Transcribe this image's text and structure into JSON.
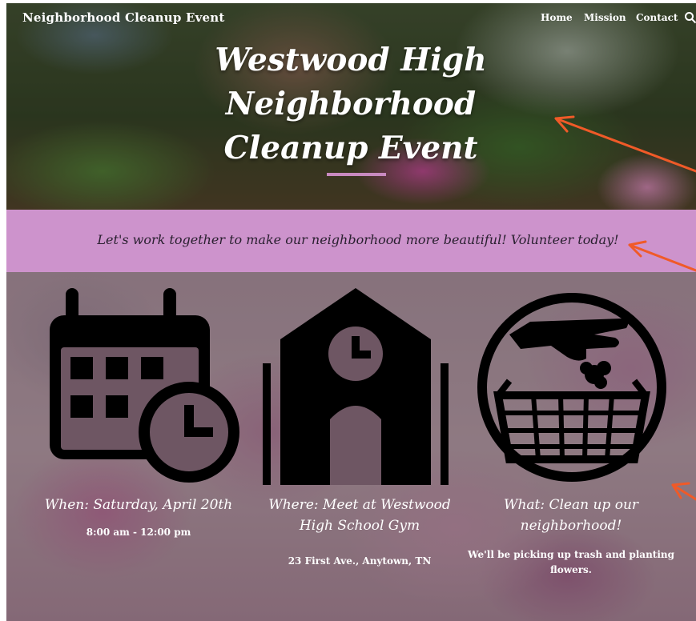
{
  "nav": {
    "site_title": "Neighborhood Cleanup Event",
    "links": [
      "Home",
      "Mission",
      "Contact"
    ],
    "search_icon": "search-icon"
  },
  "hero": {
    "title": "Westwood High Neighborhood Cleanup Event"
  },
  "banner": {
    "text": "Let's work together to make our neighborhood more beautiful! Volunteer today!"
  },
  "details": [
    {
      "icon": "calendar-clock-icon",
      "heading": "When: Saturday, April 20th",
      "detail": "8:00 am - 12:00 pm"
    },
    {
      "icon": "school-building-clock-icon",
      "heading": "Where: Meet at Westwood High School Gym",
      "detail": "23 First Ave., Anytown, TN"
    },
    {
      "icon": "hand-trash-basket-icon",
      "heading": "What: Clean up our neighborhood!",
      "detail": "We'll be picking up trash and planting flowers."
    }
  ],
  "colors": {
    "banner": "#cd93cc",
    "accent_rule": "#c88ac0",
    "annotation_arrow": "#f05a28",
    "icon": "#000000"
  }
}
